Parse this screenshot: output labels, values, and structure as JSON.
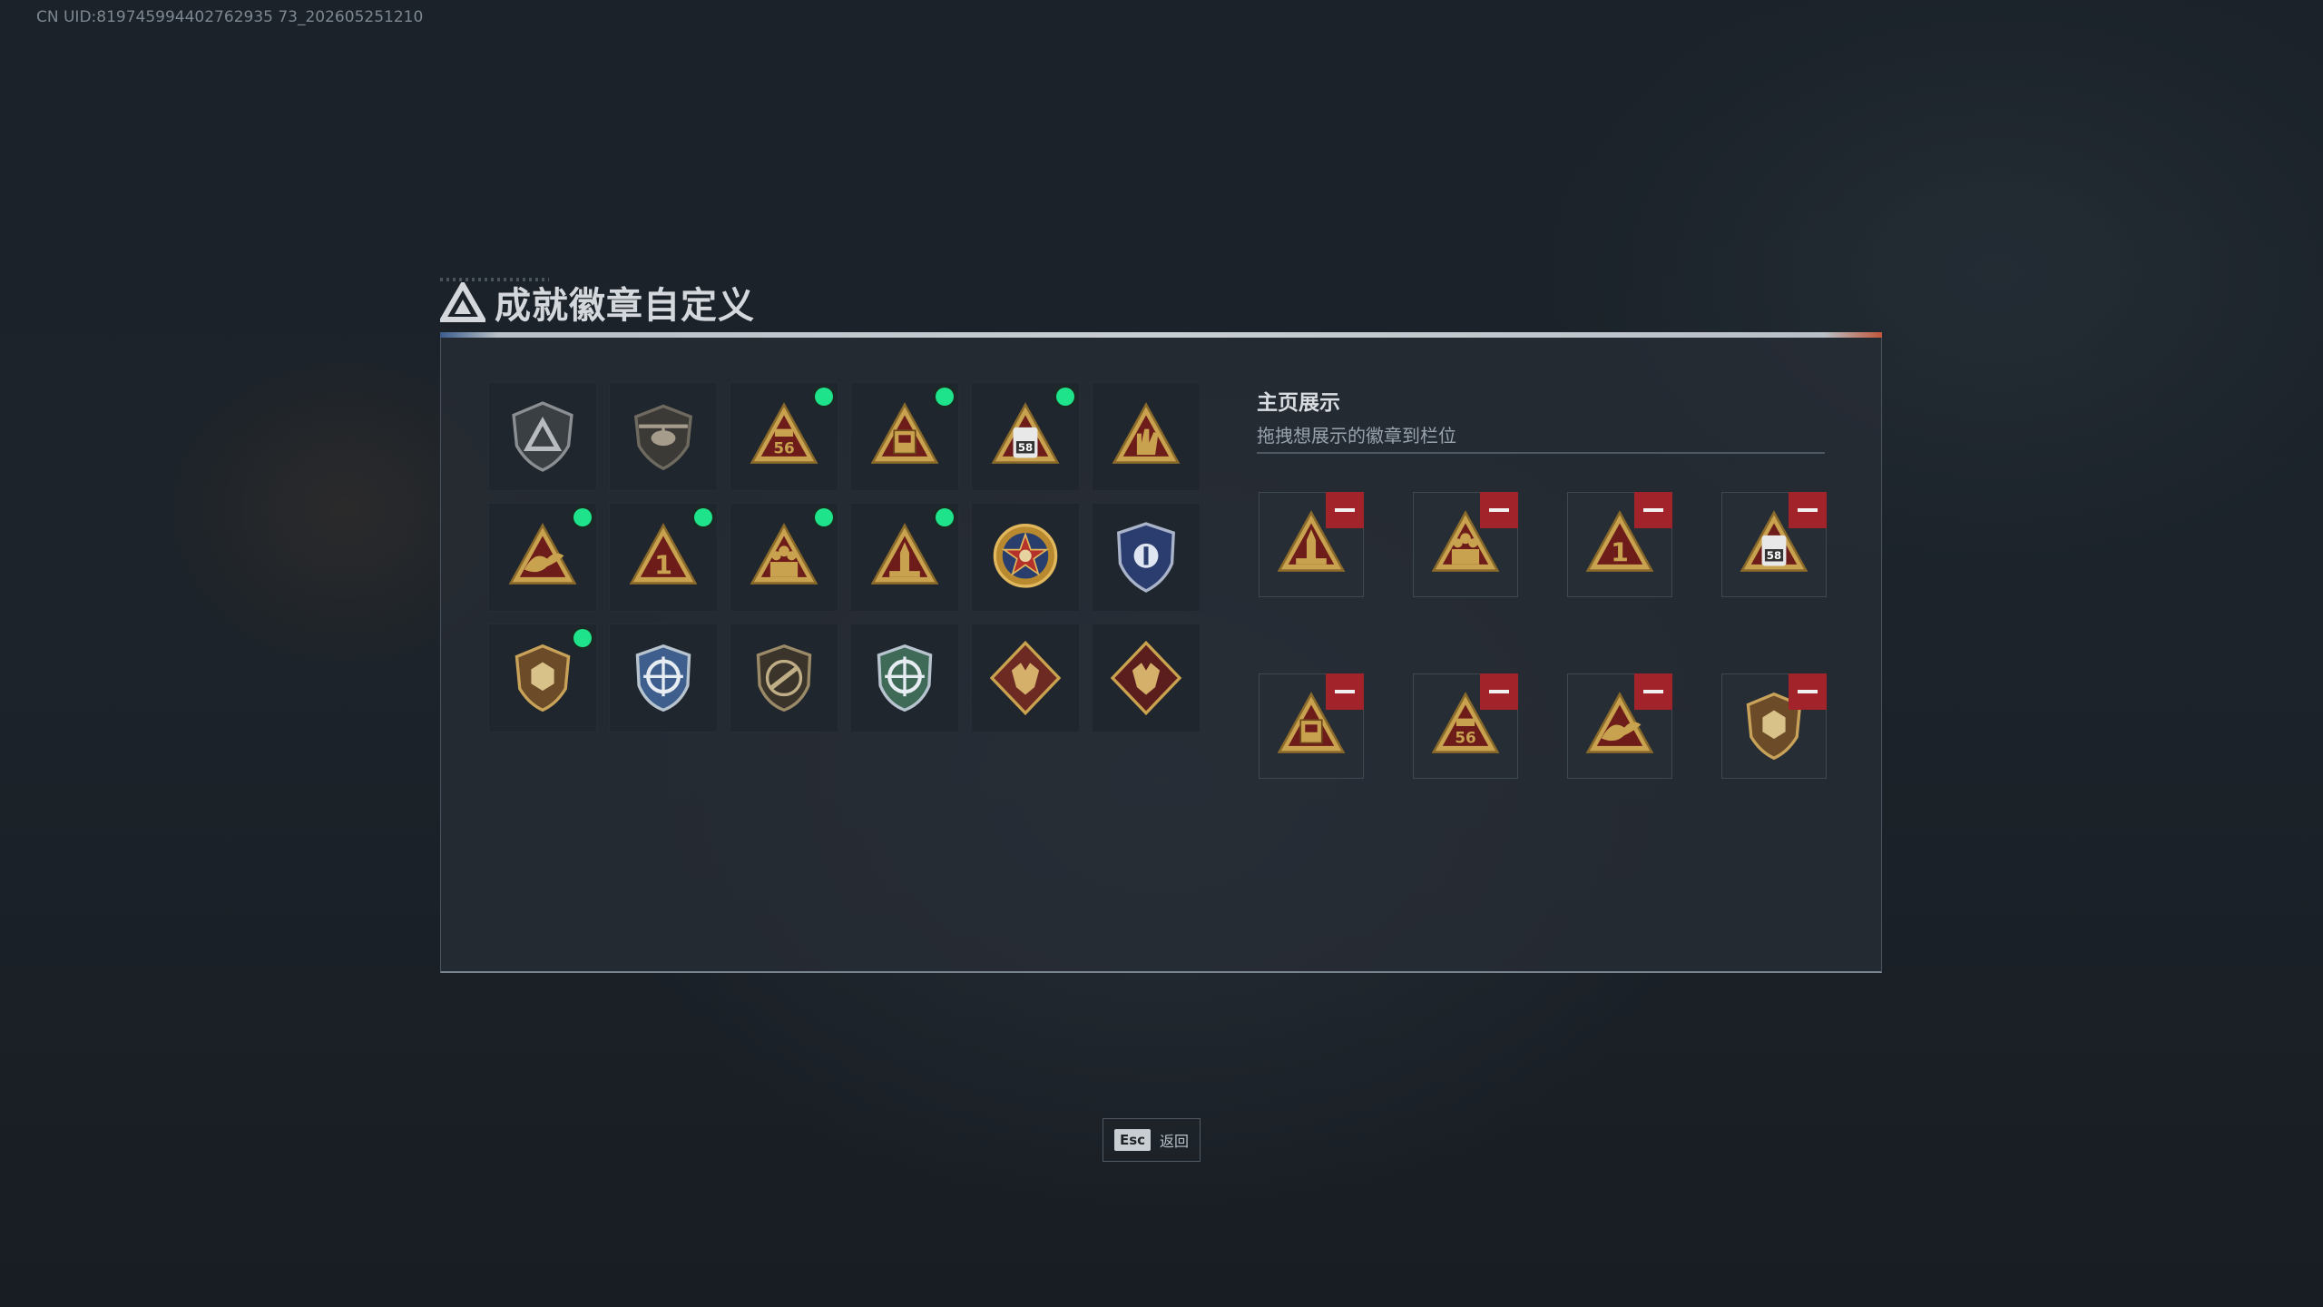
{
  "header": {
    "uid_text": "CN UID:819745994402762935 73_202605251210",
    "title": "成就徽章自定义"
  },
  "badge_grid": {
    "badges": [
      {
        "icon": "shield-delta-icon",
        "new": false
      },
      {
        "icon": "helicopter-shield-icon",
        "new": false
      },
      {
        "icon": "triangle-56-icon",
        "text": "56",
        "new": true
      },
      {
        "icon": "triangle-crate-icon",
        "new": true
      },
      {
        "icon": "triangle-58-icon",
        "text": "58",
        "new": true
      },
      {
        "icon": "triangle-hand-icon",
        "new": false
      },
      {
        "icon": "triangle-bird-icon",
        "new": true
      },
      {
        "icon": "triangle-number-one-icon",
        "text": "1",
        "new": true
      },
      {
        "icon": "triangle-squad-icon",
        "new": true
      },
      {
        "icon": "triangle-rocket-icon",
        "new": true
      },
      {
        "icon": "star-medal-icon",
        "new": false
      },
      {
        "icon": "blue-shield-emblem-icon",
        "new": false
      },
      {
        "icon": "hex-crest-shield-icon",
        "new": true
      },
      {
        "icon": "crosshair-wreath-blue-icon",
        "new": false
      },
      {
        "icon": "rifle-shield-icon",
        "new": false
      },
      {
        "icon": "crosshair-wreath-green-icon",
        "new": false
      },
      {
        "icon": "wolf-diamond-icon",
        "new": false
      },
      {
        "icon": "dragon-diamond-icon",
        "new": false
      }
    ]
  },
  "showcase": {
    "title": "主页展示",
    "subtitle": "拖拽想展示的徽章到栏位",
    "slots": [
      {
        "icon": "triangle-rocket-icon"
      },
      {
        "icon": "triangle-squad-icon"
      },
      {
        "icon": "triangle-number-one-icon",
        "text": "1"
      },
      {
        "icon": "triangle-58-icon",
        "text": "58"
      },
      {
        "icon": "triangle-crate-icon"
      },
      {
        "icon": "triangle-56-icon",
        "text": "56"
      },
      {
        "icon": "triangle-bird-icon"
      },
      {
        "icon": "hex-crest-shield-icon"
      }
    ]
  },
  "footer": {
    "esc_key": "Esc",
    "back_label": "返回"
  },
  "colors": {
    "background": "#1a2027",
    "new_dot": "#1fe38a",
    "remove_button": "#a2242a",
    "badge_gold": "#c8a24e",
    "badge_dark_red": "#6e1c1a"
  }
}
